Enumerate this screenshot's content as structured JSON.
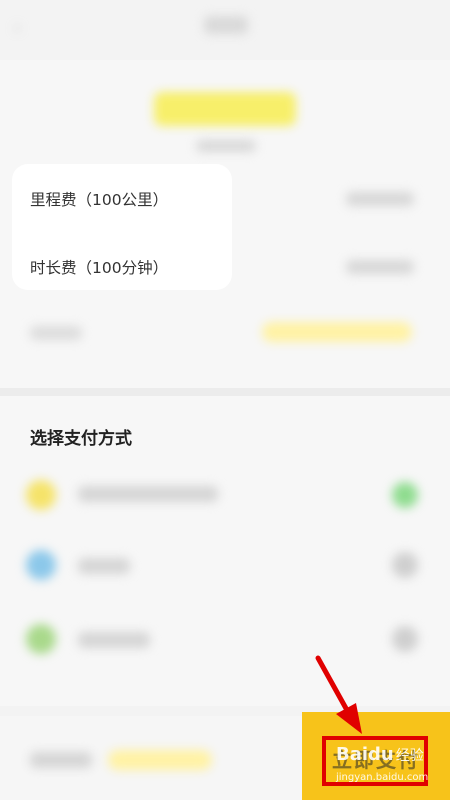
{
  "fees": [
    {
      "label": "里程费（100公里）"
    },
    {
      "label": "时长费（100分钟）"
    }
  ],
  "payment": {
    "title": "选择支付方式",
    "methods": [
      {
        "icon": "yellow-wallet-icon",
        "color": "#f5e36a",
        "selected_color": "#8fdc8f"
      },
      {
        "icon": "blue-pay-icon",
        "color": "#8cc8ea",
        "selected_color": "#cfcfcf"
      },
      {
        "icon": "green-pay-icon",
        "color": "#a9d98b",
        "selected_color": "#cfcfcf"
      }
    ]
  },
  "bottom_bar": {
    "pay_button_label": "立即支付",
    "button_color": "#f7c31a"
  },
  "watermark": {
    "logo": "Baidu",
    "suffix": "经验",
    "url": "jingyan.baidu.com"
  },
  "annotation": {
    "highlight_color": "#e00000"
  }
}
